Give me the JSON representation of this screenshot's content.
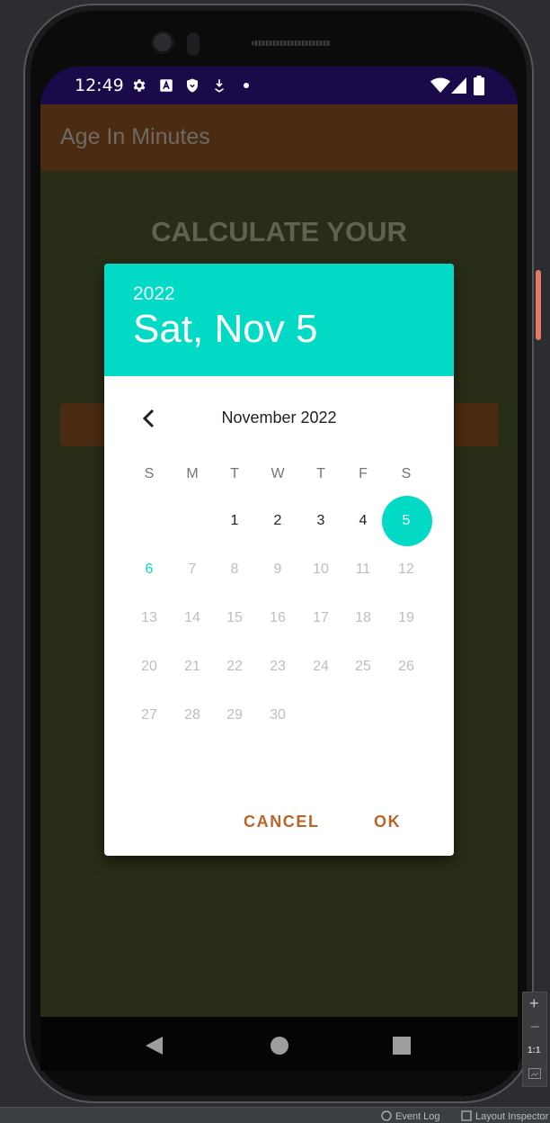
{
  "status_bar": {
    "time": "12:49",
    "left_icons": [
      "gear-icon",
      "a-icon",
      "shield-icon",
      "download-icon",
      "dot-icon"
    ],
    "right_icons": [
      "wifi-icon",
      "signal-icon",
      "battery-icon"
    ]
  },
  "app": {
    "title": "Age In Minutes",
    "heading": "CALCULATE YOUR"
  },
  "dialog": {
    "header_year": "2022",
    "header_date": "Sat, Nov 5",
    "month_label": "November 2022",
    "weekdays": [
      "S",
      "M",
      "T",
      "W",
      "T",
      "F",
      "S"
    ],
    "days": [
      "1",
      "2",
      "3",
      "4",
      "5",
      "6",
      "7",
      "8",
      "9",
      "10",
      "11",
      "12",
      "13",
      "14",
      "15",
      "16",
      "17",
      "18",
      "19",
      "20",
      "21",
      "22",
      "23",
      "24",
      "25",
      "26",
      "27",
      "28",
      "29",
      "30"
    ],
    "selected_day": "5",
    "today_day": "6",
    "cancel_label": "CANCEL",
    "ok_label": "OK",
    "accent_color": "#03dac5",
    "button_color": "#b8652a"
  },
  "nav": [
    "back-icon",
    "home-icon",
    "recents-icon"
  ],
  "ide": {
    "zoom_in": "+",
    "zoom_out": "−",
    "zoom_reset": "1:1",
    "event_log": "Event Log",
    "layout_inspector": "Layout Inspector"
  }
}
